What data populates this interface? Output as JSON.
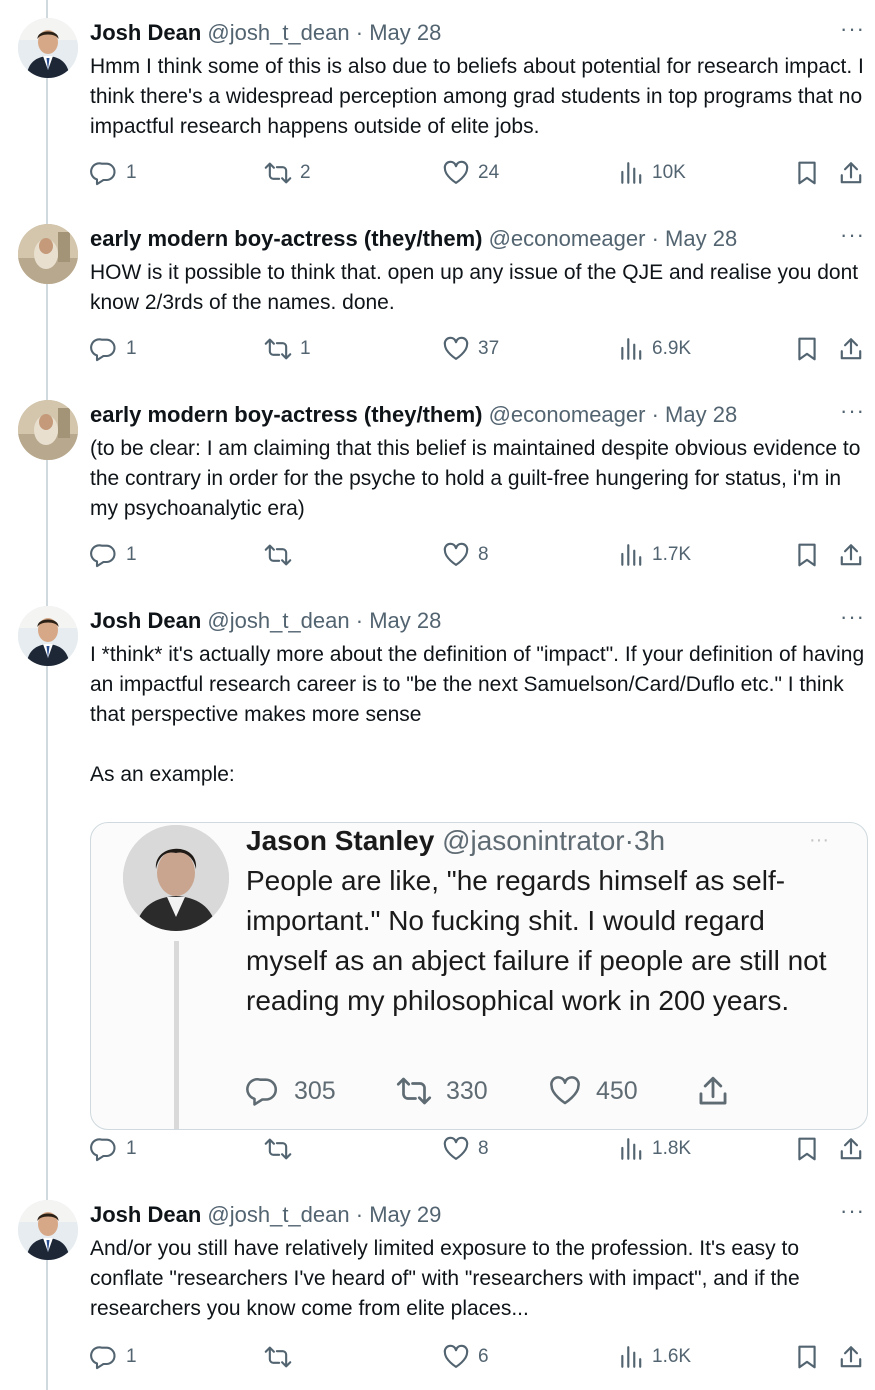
{
  "tweets": [
    {
      "name": "Josh Dean",
      "handle": "@josh_t_dean",
      "sep": "·",
      "date": "May 28",
      "more": "···",
      "text": "Hmm I think some of this is also due to beliefs about potential for research impact. I think there's a widespread perception among grad students in top programs that no impactful research happens outside of elite jobs.",
      "replies": "1",
      "retweets": "2",
      "likes": "24",
      "views": "10K"
    },
    {
      "name": "early modern boy-actress (they/them)",
      "handle": "@economeager",
      "sep": "·",
      "date": "May 28",
      "more": "···",
      "text": "HOW is it possible to think that. open up any issue of the QJE and realise you dont know 2/3rds of the names. done.",
      "replies": "1",
      "retweets": "1",
      "likes": "37",
      "views": "6.9K"
    },
    {
      "name": "early modern boy-actress (they/them)",
      "handle": "@economeager",
      "sep": "·",
      "date": "May 28",
      "more": "···",
      "text": "(to be clear: I am claiming that this belief is maintained despite obvious evidence to the contrary in order for the psyche to hold a guilt-free hungering for status, i'm in my psychoanalytic era)",
      "replies": "1",
      "retweets": "",
      "likes": "8",
      "views": "1.7K"
    },
    {
      "name": "Josh Dean",
      "handle": "@josh_t_dean",
      "sep": "·",
      "date": "May 28",
      "more": "···",
      "text": "I *think* it's actually more about the definition of \"impact\". If your definition of having an impactful research career is to \"be the next Samuelson/Card/Duflo etc.\" I think that perspective makes more sense\n\nAs an example:",
      "replies": "1",
      "retweets": "",
      "likes": "8",
      "views": "1.8K",
      "embed": {
        "name": "Jason Stanley",
        "handle": "@jasonintrator",
        "sep": "·",
        "date": "3h",
        "more": "···",
        "text": "People are like, \"he regards himself as self-important.\" No fucking shit. I would regard myself as an abject failure if people are still not reading my philosophical work in 200 years.",
        "replies": "305",
        "retweets": "330",
        "likes": "450"
      }
    },
    {
      "name": "Josh Dean",
      "handle": "@josh_t_dean",
      "sep": "·",
      "date": "May 29",
      "more": "···",
      "text": "And/or you still have relatively limited exposure to the profession. It's easy to conflate \"researchers I've heard of\" with \"researchers with impact\", and if the researchers you know come from elite places...",
      "replies": "1",
      "retweets": "",
      "likes": "6",
      "views": "1.6K"
    }
  ],
  "icons": {
    "reply": "reply-icon",
    "retweet": "retweet-icon",
    "like": "heart-icon",
    "views": "views-icon",
    "bookmark": "bookmark-icon",
    "share": "share-icon"
  },
  "colors": {
    "text": "#0f1419",
    "muted": "#536471",
    "border": "#cfd9de"
  }
}
